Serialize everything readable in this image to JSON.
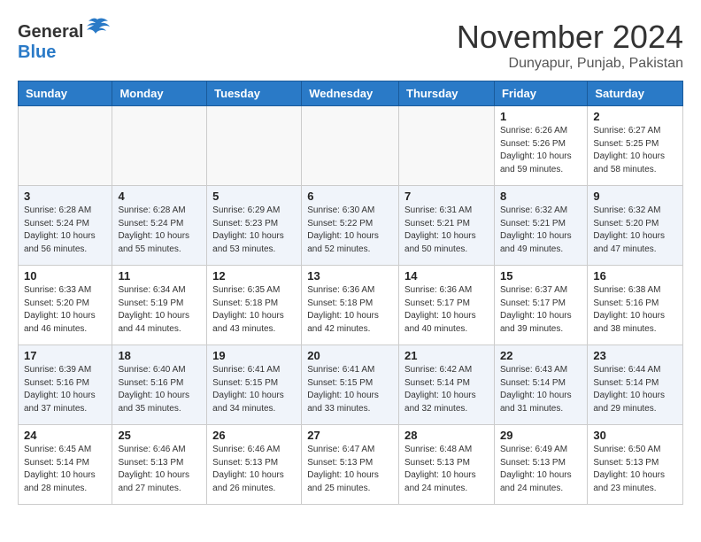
{
  "header": {
    "logo_general": "General",
    "logo_blue": "Blue",
    "main_title": "November 2024",
    "subtitle": "Dunyapur, Punjab, Pakistan"
  },
  "calendar": {
    "days": [
      "Sunday",
      "Monday",
      "Tuesday",
      "Wednesday",
      "Thursday",
      "Friday",
      "Saturday"
    ],
    "weeks": [
      [
        {
          "day": "",
          "info": ""
        },
        {
          "day": "",
          "info": ""
        },
        {
          "day": "",
          "info": ""
        },
        {
          "day": "",
          "info": ""
        },
        {
          "day": "",
          "info": ""
        },
        {
          "day": "1",
          "info": "Sunrise: 6:26 AM\nSunset: 5:26 PM\nDaylight: 10 hours and 59 minutes."
        },
        {
          "day": "2",
          "info": "Sunrise: 6:27 AM\nSunset: 5:25 PM\nDaylight: 10 hours and 58 minutes."
        }
      ],
      [
        {
          "day": "3",
          "info": "Sunrise: 6:28 AM\nSunset: 5:24 PM\nDaylight: 10 hours and 56 minutes."
        },
        {
          "day": "4",
          "info": "Sunrise: 6:28 AM\nSunset: 5:24 PM\nDaylight: 10 hours and 55 minutes."
        },
        {
          "day": "5",
          "info": "Sunrise: 6:29 AM\nSunset: 5:23 PM\nDaylight: 10 hours and 53 minutes."
        },
        {
          "day": "6",
          "info": "Sunrise: 6:30 AM\nSunset: 5:22 PM\nDaylight: 10 hours and 52 minutes."
        },
        {
          "day": "7",
          "info": "Sunrise: 6:31 AM\nSunset: 5:21 PM\nDaylight: 10 hours and 50 minutes."
        },
        {
          "day": "8",
          "info": "Sunrise: 6:32 AM\nSunset: 5:21 PM\nDaylight: 10 hours and 49 minutes."
        },
        {
          "day": "9",
          "info": "Sunrise: 6:32 AM\nSunset: 5:20 PM\nDaylight: 10 hours and 47 minutes."
        }
      ],
      [
        {
          "day": "10",
          "info": "Sunrise: 6:33 AM\nSunset: 5:20 PM\nDaylight: 10 hours and 46 minutes."
        },
        {
          "day": "11",
          "info": "Sunrise: 6:34 AM\nSunset: 5:19 PM\nDaylight: 10 hours and 44 minutes."
        },
        {
          "day": "12",
          "info": "Sunrise: 6:35 AM\nSunset: 5:18 PM\nDaylight: 10 hours and 43 minutes."
        },
        {
          "day": "13",
          "info": "Sunrise: 6:36 AM\nSunset: 5:18 PM\nDaylight: 10 hours and 42 minutes."
        },
        {
          "day": "14",
          "info": "Sunrise: 6:36 AM\nSunset: 5:17 PM\nDaylight: 10 hours and 40 minutes."
        },
        {
          "day": "15",
          "info": "Sunrise: 6:37 AM\nSunset: 5:17 PM\nDaylight: 10 hours and 39 minutes."
        },
        {
          "day": "16",
          "info": "Sunrise: 6:38 AM\nSunset: 5:16 PM\nDaylight: 10 hours and 38 minutes."
        }
      ],
      [
        {
          "day": "17",
          "info": "Sunrise: 6:39 AM\nSunset: 5:16 PM\nDaylight: 10 hours and 37 minutes."
        },
        {
          "day": "18",
          "info": "Sunrise: 6:40 AM\nSunset: 5:16 PM\nDaylight: 10 hours and 35 minutes."
        },
        {
          "day": "19",
          "info": "Sunrise: 6:41 AM\nSunset: 5:15 PM\nDaylight: 10 hours and 34 minutes."
        },
        {
          "day": "20",
          "info": "Sunrise: 6:41 AM\nSunset: 5:15 PM\nDaylight: 10 hours and 33 minutes."
        },
        {
          "day": "21",
          "info": "Sunrise: 6:42 AM\nSunset: 5:14 PM\nDaylight: 10 hours and 32 minutes."
        },
        {
          "day": "22",
          "info": "Sunrise: 6:43 AM\nSunset: 5:14 PM\nDaylight: 10 hours and 31 minutes."
        },
        {
          "day": "23",
          "info": "Sunrise: 6:44 AM\nSunset: 5:14 PM\nDaylight: 10 hours and 29 minutes."
        }
      ],
      [
        {
          "day": "24",
          "info": "Sunrise: 6:45 AM\nSunset: 5:14 PM\nDaylight: 10 hours and 28 minutes."
        },
        {
          "day": "25",
          "info": "Sunrise: 6:46 AM\nSunset: 5:13 PM\nDaylight: 10 hours and 27 minutes."
        },
        {
          "day": "26",
          "info": "Sunrise: 6:46 AM\nSunset: 5:13 PM\nDaylight: 10 hours and 26 minutes."
        },
        {
          "day": "27",
          "info": "Sunrise: 6:47 AM\nSunset: 5:13 PM\nDaylight: 10 hours and 25 minutes."
        },
        {
          "day": "28",
          "info": "Sunrise: 6:48 AM\nSunset: 5:13 PM\nDaylight: 10 hours and 24 minutes."
        },
        {
          "day": "29",
          "info": "Sunrise: 6:49 AM\nSunset: 5:13 PM\nDaylight: 10 hours and 24 minutes."
        },
        {
          "day": "30",
          "info": "Sunrise: 6:50 AM\nSunset: 5:13 PM\nDaylight: 10 hours and 23 minutes."
        }
      ]
    ]
  }
}
